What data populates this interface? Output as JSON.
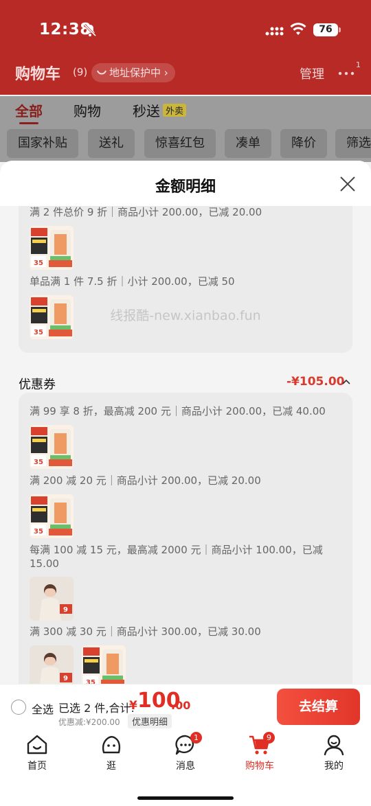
{
  "status_bar": {
    "time": "12:38",
    "battery": "76"
  },
  "cart_header": {
    "title": "购物车",
    "count": "(9)",
    "address_protection": "地址保护中",
    "manage": "管理",
    "more_badge": "1"
  },
  "tabs": [
    {
      "label": "全部"
    },
    {
      "label": "购物"
    },
    {
      "label": "秒送",
      "badge": "外卖"
    }
  ],
  "filters": [
    "国家补贴",
    "送礼",
    "惊喜红包",
    "凑单",
    "降价",
    "筛选"
  ],
  "sheet": {
    "title": "金额明细",
    "promo_rules": [
      "满 2 件总价 9 折｜商品小计 200.00，已减 20.00",
      "单品满 1 件 7.5 折｜小计 200.00，已减 50"
    ],
    "coupon": {
      "label": "优惠券",
      "amount": "-¥105.00",
      "rules": [
        "满 99 享 8 折，最高减 200 元｜商品小计 200.00，已减 40.00",
        "满 200 减 20 元｜商品小计 200.00，已减 20.00",
        "每满 100 减 15 元，最高减 2000 元｜商品小计 100.00，已减 15.00",
        "满 300 减 30 元｜商品小计 300.00，已减 30.00"
      ]
    },
    "watermark": "线报酷-new.xianbao.fun",
    "thumbnails": {
      "product_a_badge": "35",
      "product_b_badge": "9"
    }
  },
  "checkout": {
    "select_all": "全选",
    "selected_info": "已选 2 件,合计:",
    "currency": "¥",
    "total_int": "100",
    "total_dec": ".00",
    "discount": "优惠减:¥200.00",
    "detail_link": "优惠明细",
    "button": "去结算"
  },
  "tabbar": [
    {
      "label": "首页",
      "icon": "home-icon"
    },
    {
      "label": "逛",
      "icon": "browse-icon"
    },
    {
      "label": "消息",
      "icon": "message-icon",
      "badge": "1"
    },
    {
      "label": "购物车",
      "icon": "cart-icon",
      "badge": "9",
      "active": true
    },
    {
      "label": "我的",
      "icon": "profile-icon"
    }
  ],
  "colors": {
    "brand_red": "#e02e24",
    "header_red": "#b82a26"
  }
}
